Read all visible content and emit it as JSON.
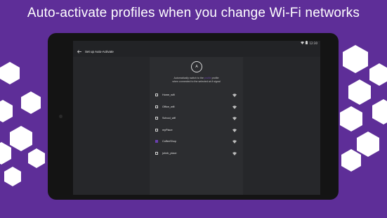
{
  "hero": {
    "title": "Auto-activate profiles when you change Wi-Fi networks"
  },
  "status_bar": {
    "wifi_icon": "wifi-icon",
    "battery_icon": "battery-icon",
    "time": "12:30"
  },
  "app_bar": {
    "back_icon": "arrow-back-icon",
    "title": "Set up Auto-Activate"
  },
  "header": {
    "logo_letter": "A",
    "description_line1_pre": "Automatically switch to the ",
    "description_line1_highlight": "profile",
    "description_line1_post": " profile",
    "description_line2": "when connected to the selected wi-fi signal"
  },
  "networks": [
    {
      "label": "Home_wifi",
      "checked": false,
      "signal_icon": "wifi-signal-icon"
    },
    {
      "label": "Office_wifi",
      "checked": false,
      "signal_icon": "wifi-signal-icon"
    },
    {
      "label": "School_wifi",
      "checked": false,
      "signal_icon": "wifi-signal-icon"
    },
    {
      "label": "myPlace",
      "checked": false,
      "signal_icon": "wifi-signal-icon"
    },
    {
      "label": "CoffeeShop",
      "checked": true,
      "signal_icon": "wifi-signal-icon"
    },
    {
      "label": "johnb_place",
      "checked": false,
      "signal_icon": "wifi-signal-icon"
    }
  ],
  "colors": {
    "background": "#5e2e98",
    "accent": "#6a3fb0",
    "screen": "#2c2d30",
    "side_panel": "#26272a"
  }
}
